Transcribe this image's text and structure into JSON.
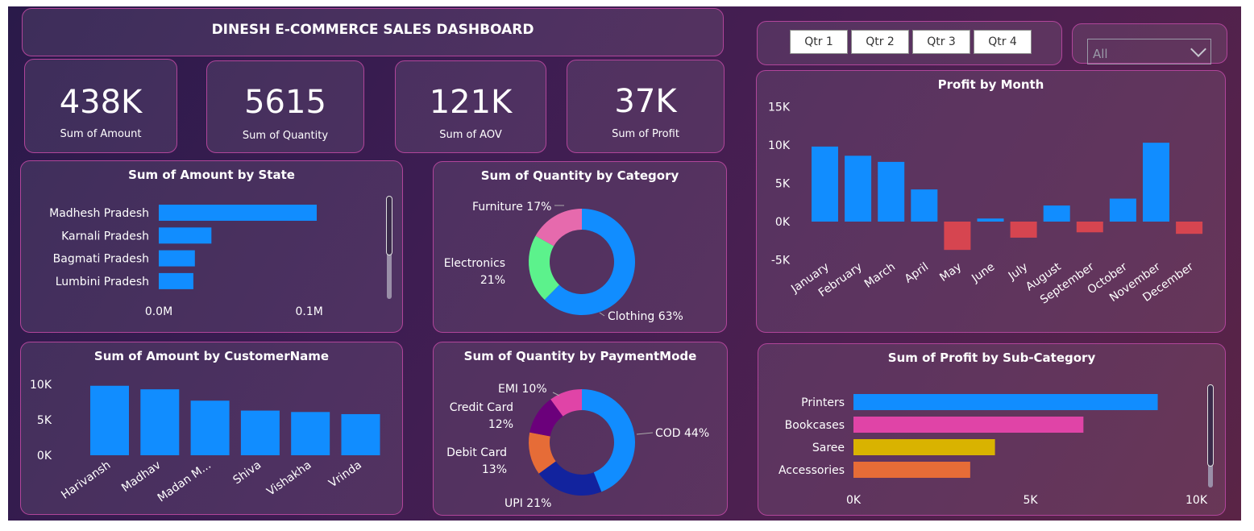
{
  "dashboard_title": "DINESH E-COMMERCE SALES DASHBOARD",
  "kpis": [
    {
      "value": "438K",
      "label": "Sum of Amount"
    },
    {
      "value": "5615",
      "label": "Sum of Quantity"
    },
    {
      "value": "121K",
      "label": "Sum of AOV"
    },
    {
      "value": "37K",
      "label": "Sum of Profit"
    }
  ],
  "quarter_slicer": [
    "Qtr 1",
    "Qtr 2",
    "Qtr 3",
    "Qtr 4"
  ],
  "state_dropdown": {
    "selected": "All",
    "icon": "chevron-down-icon"
  },
  "colors": {
    "blue": "#118dff",
    "red": "#d64550",
    "pink": "#e044a7",
    "gold": "#d9b300",
    "orange": "#e66c37",
    "green": "#5cf28c",
    "navy": "#12239e",
    "purple": "#6b007b",
    "lightpink": "#e66aad",
    "panel_border": "#b0459a"
  },
  "chart_data": [
    {
      "id": "amount_by_state",
      "type": "bar",
      "orientation": "horizontal",
      "title": "Sum of Amount by State",
      "categories": [
        "Madhesh Pradesh",
        "Karnali Pradesh",
        "Bagmati Pradesh",
        "Lumbini Pradesh"
      ],
      "values": [
        0.105,
        0.035,
        0.024,
        0.023
      ],
      "xticks": [
        "0.0M",
        "0.1M"
      ],
      "xlim": [
        0,
        0.105
      ],
      "color": "#118dff"
    },
    {
      "id": "quantity_by_category",
      "type": "pie",
      "donut": true,
      "title": "Sum of Quantity by Category",
      "categories": [
        "Clothing",
        "Electronics",
        "Furniture"
      ],
      "values": [
        63,
        21,
        17
      ],
      "labels": [
        "Clothing 63%",
        "Electronics",
        "21%",
        "Furniture 17%"
      ],
      "colors": [
        "#118dff",
        "#5cf28c",
        "#e66aad"
      ]
    },
    {
      "id": "profit_by_month",
      "type": "bar",
      "title": "Profit by Month",
      "categories": [
        "January",
        "February",
        "March",
        "April",
        "May",
        "June",
        "July",
        "August",
        "September",
        "October",
        "November",
        "December"
      ],
      "values": [
        9800,
        8600,
        7800,
        4200,
        -3700,
        400,
        -2100,
        2100,
        -1400,
        3000,
        10300,
        -1600
      ],
      "yticks": [
        "15K",
        "10K",
        "5K",
        "0K",
        "-5K"
      ],
      "ylim": [
        -5000,
        15000
      ],
      "positive_color": "#118dff",
      "negative_color": "#d64550"
    },
    {
      "id": "amount_by_customer",
      "type": "bar",
      "title": "Sum of Amount by CustomerName",
      "categories": [
        "Harivansh",
        "Madhav",
        "Madan M...",
        "Shiva",
        "Vishakha",
        "Vrinda"
      ],
      "values": [
        9800,
        9300,
        7700,
        6300,
        6100,
        5800
      ],
      "yticks": [
        "10K",
        "5K",
        "0K"
      ],
      "ylim": [
        0,
        10000
      ],
      "color": "#118dff"
    },
    {
      "id": "quantity_by_paymentmode",
      "type": "pie",
      "donut": true,
      "title": "Sum of Quantity by PaymentMode",
      "categories": [
        "COD",
        "UPI",
        "Debit Card",
        "Credit Card",
        "EMI"
      ],
      "values": [
        44,
        21,
        13,
        12,
        10
      ],
      "labels": [
        "COD 44%",
        "UPI 21%",
        "Debit Card",
        "13%",
        "Credit Card",
        "12%",
        "EMI 10%"
      ],
      "colors": [
        "#118dff",
        "#12239e",
        "#e66c37",
        "#6b007b",
        "#e044a7"
      ]
    },
    {
      "id": "profit_by_subcategory",
      "type": "bar",
      "orientation": "horizontal",
      "title": "Sum of Profit by Sub-Category",
      "categories": [
        "Printers",
        "Bookcases",
        "Saree",
        "Accessories"
      ],
      "values": [
        8600,
        6500,
        4000,
        3300
      ],
      "xticks": [
        "0K",
        "5K",
        "10K"
      ],
      "xlim": [
        0,
        10000
      ],
      "colors": [
        "#118dff",
        "#e044a7",
        "#d9b300",
        "#e66c37"
      ]
    }
  ]
}
